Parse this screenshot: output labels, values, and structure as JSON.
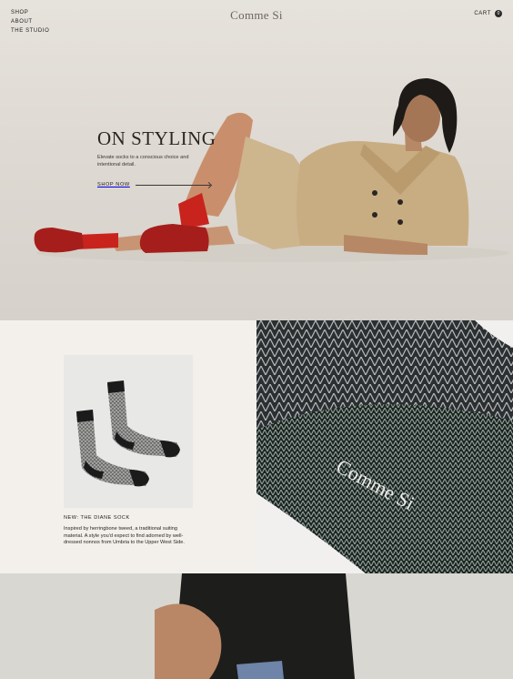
{
  "nav": {
    "links": [
      "SHOP",
      "ABOUT",
      "THE STUDIO"
    ],
    "logo": "Comme Si",
    "cart_label": "CART",
    "cart_count": "0"
  },
  "hero": {
    "title": "ON STYLING",
    "subtitle": "Elevate socks to a conscious choice and intentional detail.",
    "cta": "SHOP NOW"
  },
  "product": {
    "title": "NEW: THE DIANE SOCK",
    "description": "Inspired by herringbone tweed, a traditional suiting material. A style you'd expect to find adorned by well-dressed nonnos from Umbria to the Upper West Side.",
    "sock_label": "Comme Si"
  },
  "knit_label": "Comme Si",
  "colors": {
    "background": "#f3f0ec",
    "hero_bg": "#e0dbd4",
    "accent_red": "#c8241d",
    "coat_tan": "#cdb58e",
    "knit_dark": "#1f2a26"
  }
}
